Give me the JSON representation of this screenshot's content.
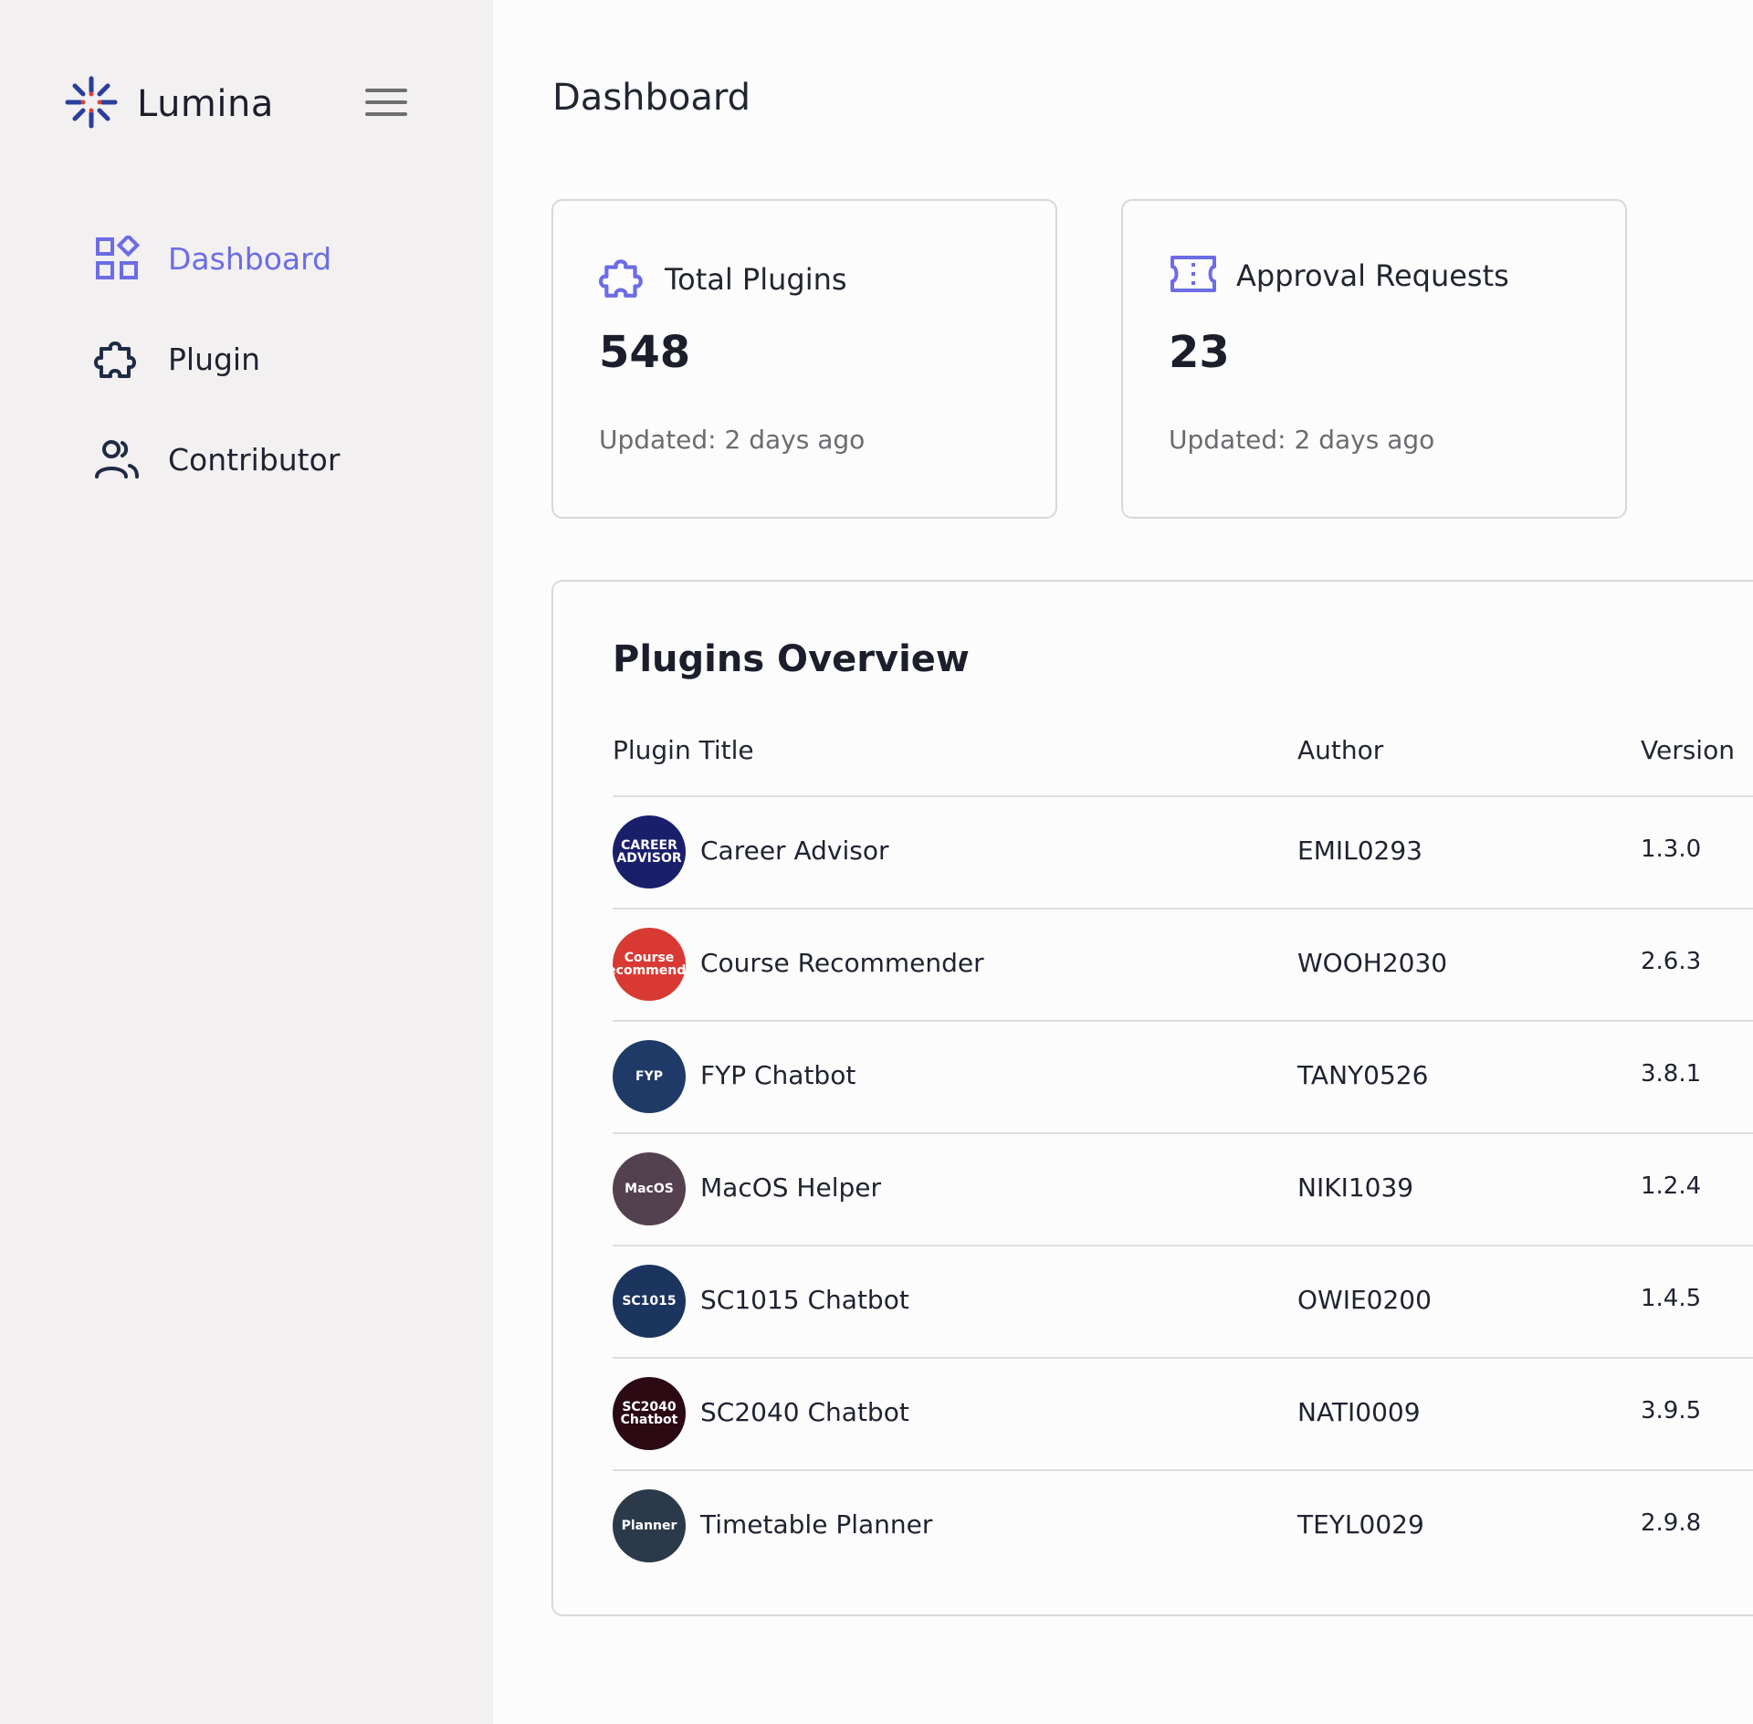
{
  "brand": {
    "name": "Lumina",
    "icon": "lumina-logo-icon"
  },
  "sidebar": {
    "menu_icon": "hamburger-icon",
    "items": [
      {
        "label": "Dashboard",
        "icon": "dashboard-icon",
        "active": true
      },
      {
        "label": "Plugin",
        "icon": "puzzle-icon",
        "active": false
      },
      {
        "label": "Contributor",
        "icon": "users-icon",
        "active": false
      }
    ]
  },
  "page": {
    "title": "Dashboard"
  },
  "cards": [
    {
      "title": "Total Plugins",
      "icon": "puzzle-icon",
      "value": "548",
      "updated": "Updated: 2 days ago"
    },
    {
      "title": "Approval Requests",
      "icon": "ticket-icon",
      "value": "23",
      "updated": "Updated: 2 days ago"
    }
  ],
  "overview": {
    "title": "Plugins Overview",
    "columns": [
      "Plugin Title",
      "Author",
      "Version"
    ],
    "rows": [
      {
        "title": "Career Advisor",
        "author": "EMIL0293",
        "version": "1.3.0",
        "avatar_text": "CAREER ADVISOR",
        "avatar_color": "#1a1f6b"
      },
      {
        "title": "Course Recommender",
        "author": "WOOH2030",
        "version": "2.6.3",
        "avatar_text": "Course Recommender",
        "avatar_color": "#d83a33"
      },
      {
        "title": "FYP Chatbot",
        "author": "TANY0526",
        "version": "3.8.1",
        "avatar_text": "FYP",
        "avatar_color": "#1f3a66"
      },
      {
        "title": "MacOS Helper",
        "author": "NIKI1039",
        "version": "1.2.4",
        "avatar_text": "MacOS",
        "avatar_color": "#54414f"
      },
      {
        "title": "SC1015 Chatbot",
        "author": "OWIE0200",
        "version": "1.4.5",
        "avatar_text": "SC1015",
        "avatar_color": "#1b355f"
      },
      {
        "title": "SC2040 Chatbot",
        "author": "NATI0009",
        "version": "3.9.5",
        "avatar_text": "SC2040 Chatbot",
        "avatar_color": "#2b0a14"
      },
      {
        "title": "Timetable Planner",
        "author": "TEYL0029",
        "version": "2.9.8",
        "avatar_text": "Planner",
        "avatar_color": "#2b3a4a"
      }
    ]
  },
  "colors": {
    "accent": "#6c6ce6",
    "sidebar_bg": "#f2f0f1",
    "logo_blue": "#2a3e9a",
    "logo_red": "#d8443c"
  }
}
